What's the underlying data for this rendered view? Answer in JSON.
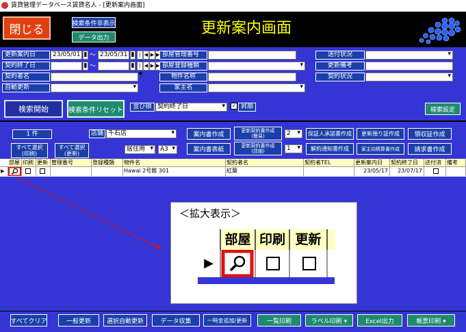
{
  "window": {
    "title": "賃貸管理データベース賃貸名人 - [更新案内画面]"
  },
  "header": {
    "close_label": "閉じる",
    "toggle_search_label": "検索条件非表示",
    "data_output_label": "データ出力",
    "title": "更新案内画面"
  },
  "search": {
    "renewal_date_label": "更新案内日",
    "renewal_from": "23/05/01",
    "renewal_to": "23/05/31",
    "tilde": "～",
    "contract_end_label": "契約終了日",
    "contractor_label": "契約者名",
    "auto_renew_label": "自動更新",
    "dept_code_label": "部屋管理番号",
    "dept_type_label": "部屋登録種類",
    "property_name_label": "物件名称",
    "owner_label": "家主名",
    "send_status_label": "送付状況",
    "renew_remark_label": "更新備考",
    "contract_status_label": "契約状況",
    "nav_first": "|◀",
    "nav_prev": "◀",
    "nav_next": "▶",
    "nav_last": "▶|"
  },
  "actions": {
    "start_label": "検索開始",
    "reset_label": "検索条件リセット",
    "sort_label": "並び順",
    "sort_value": "契約終了日",
    "asc_label": "昇順",
    "settings_label": "検索設定"
  },
  "toolbar": {
    "count": "1 件",
    "store_label": "店舗",
    "store_value": "千石店",
    "select_all_print": "すべて選択\n(印刷)",
    "select_all_renew": "すべて選択\n(更新)",
    "residence_value": "居住用",
    "paper_value": "A3",
    "btn_notice": "案内書作成",
    "btn_notice_form": "案内書表紙",
    "btn_renew_simple": "更新契約書作成\n(簡易)",
    "btn_renew_detail": "更新契約書作成\n(詳細)",
    "copies1": "2",
    "copies2": "1",
    "btn_guarantor": "保証人承諾書作成",
    "btn_cancel_notice": "解約通知書作成",
    "btn_deposit": "更新預り証作成",
    "btn_owner_fee": "家主向精算書作成",
    "btn_receipt": "領収証作成",
    "btn_invoice": "請求書作成"
  },
  "table": {
    "headers": [
      "部屋",
      "印刷",
      "更新",
      "管理番号",
      "登録種類",
      "物件名",
      "契約者名",
      "契約者TEL",
      "更新案内日",
      "契約終了日",
      "送付済",
      "備考"
    ],
    "row": {
      "mgmt_no": "",
      "type": "",
      "property": "Hawai 2号館 301",
      "contractor": "紅葉",
      "tel": "",
      "renewal_date": "23/05/17",
      "end_date": "23/07/17",
      "remark": ""
    }
  },
  "zoom": {
    "title": "＜拡大表示＞",
    "h_room": "部屋",
    "h_print": "印刷",
    "h_renew": "更新"
  },
  "bottom": {
    "clear_all": "すべてクリア",
    "general_update": "一般更新",
    "auto_update": "選択自動更新",
    "data_collect": "データ収集",
    "temp_add": "一時金追加/更新",
    "list_print": "一覧印刷",
    "label_print": "ラベル印刷 ▾",
    "excel": "Excel出力",
    "form_print": "帳票印刷 ▾"
  },
  "colors": {
    "bg": "#3535d5",
    "accent_green": "#1f8a6e",
    "accent_blue": "#1a3fa8",
    "title_yellow": "#ffff00",
    "highlight_red": "#e01010"
  }
}
